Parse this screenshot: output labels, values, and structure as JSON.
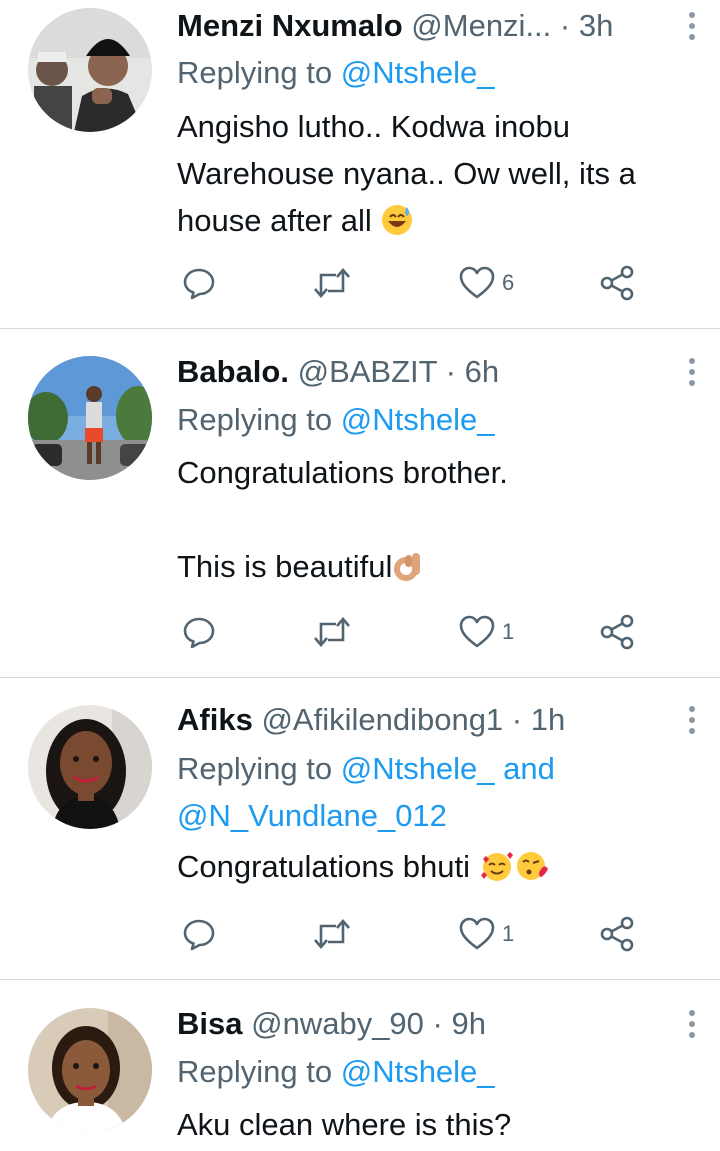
{
  "tweets": [
    {
      "name": "Menzi Nxumalo",
      "handle": "@Menzi...",
      "dot": "·",
      "time": "3h",
      "replying_prefix": "Replying to ",
      "replying_mentions": "@Ntshele_",
      "text_lines": [
        "Angisho lutho.. Kodwa inobu",
        "Warehouse nyana.. Ow well, its a",
        "house after all"
      ],
      "emojis": [
        "sweat-smile-emoji"
      ],
      "likes": "6"
    },
    {
      "name": "Babalo.",
      "handle": "@BABZIT",
      "dot": "·",
      "time": "6h",
      "replying_prefix": "Replying to ",
      "replying_mentions": "@Ntshele_",
      "text_lines": [
        "Congratulations brother.",
        "",
        "This is beautiful"
      ],
      "emojis": [
        "ok-hand-emoji"
      ],
      "likes": "1"
    },
    {
      "name": "Afiks",
      "handle": "@Afikilendibong1",
      "dot": "·",
      "time": "1h",
      "replying_prefix": "Replying to ",
      "replying_mentions": "@Ntshele_ and",
      "replying_mentions_2": "@N_Vundlane_012",
      "text_lines": [
        "Congratulations bhuti"
      ],
      "emojis": [
        "smiling-face-with-hearts-emoji",
        "face-blowing-kiss-emoji"
      ],
      "likes": "1"
    },
    {
      "name": "Bisa",
      "handle": "@nwaby_90",
      "dot": "·",
      "time": "9h",
      "replying_prefix": "Replying to ",
      "replying_mentions": "@Ntshele_",
      "text_lines": [
        "Aku clean where is this?"
      ]
    }
  ],
  "icons": {
    "reply": "reply-icon",
    "retweet": "retweet-icon",
    "like": "heart-icon",
    "share": "share-icon",
    "more": "more-options-icon"
  },
  "colors": {
    "text": "#0f1419",
    "secondary": "#536471",
    "link": "#1d9bf0",
    "divider": "#cfd9de"
  }
}
